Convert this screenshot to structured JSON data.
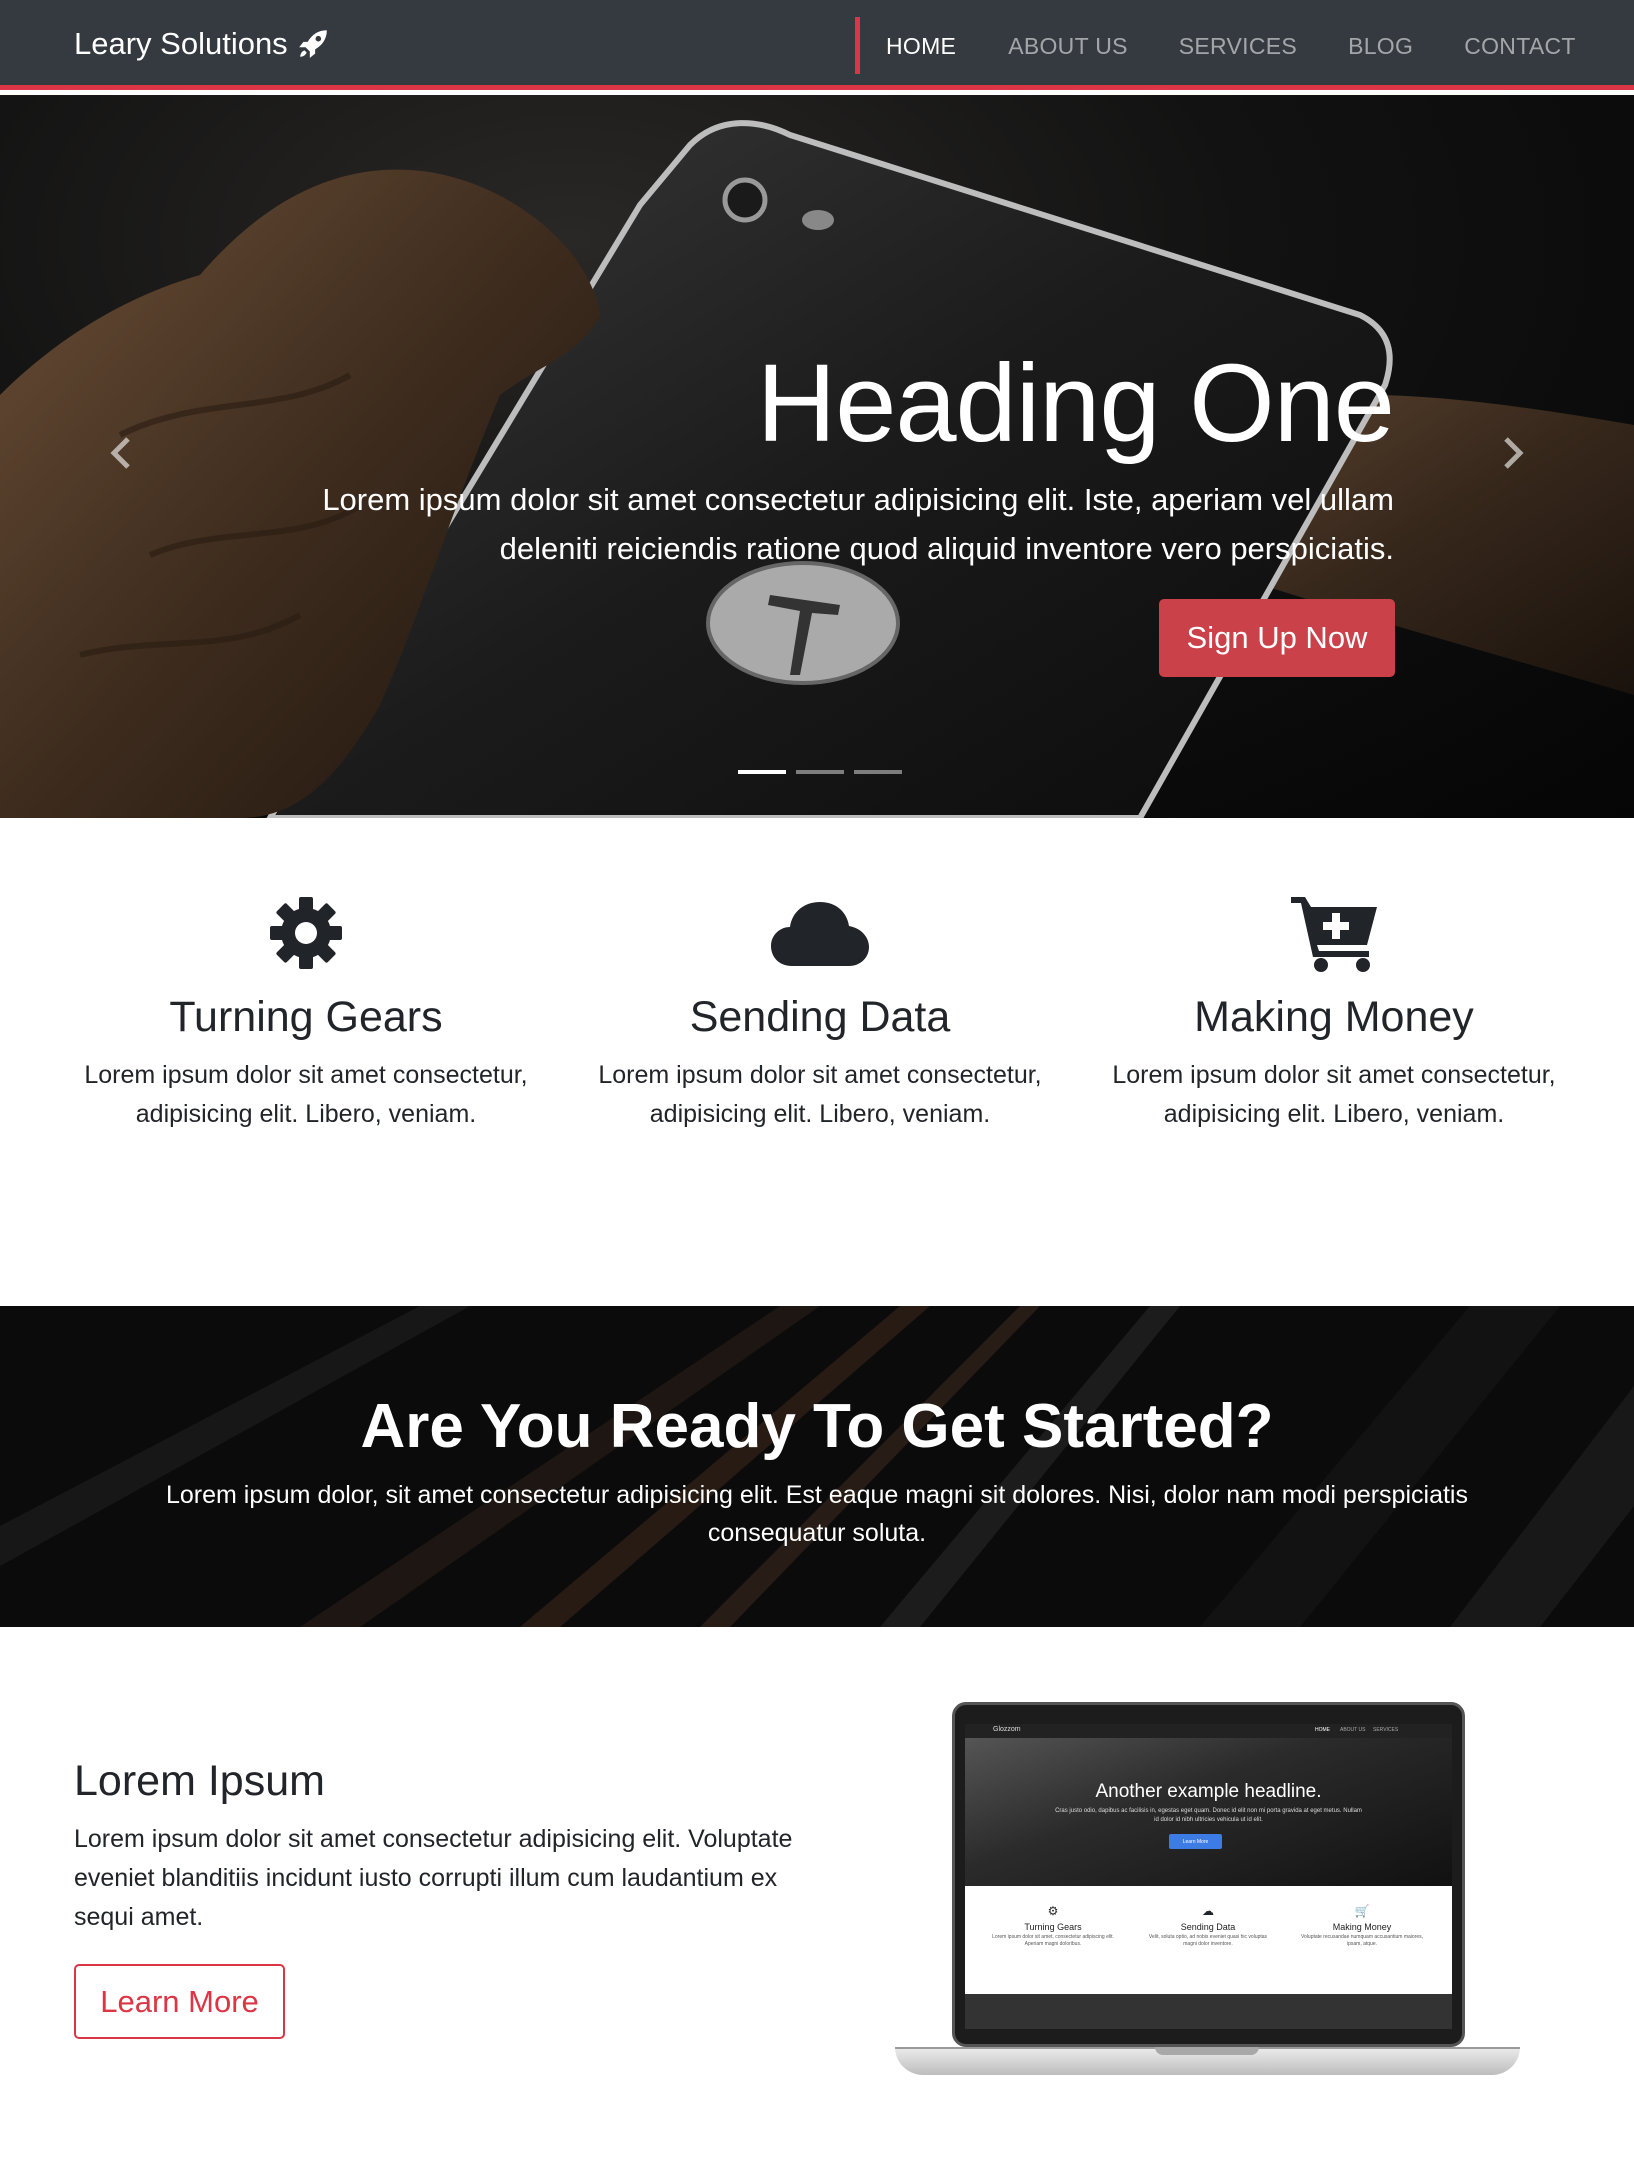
{
  "navbar": {
    "brand": "Leary Solutions",
    "brand_icon": "rocket-icon",
    "links": [
      "HOME",
      "ABOUT US",
      "SERVICES",
      "BLOG",
      "CONTACT"
    ],
    "active": "HOME",
    "accent": "#dc3545",
    "bg": "#343a40"
  },
  "hero": {
    "title": "Heading One",
    "text": "Lorem ipsum dolor sit amet consectetur adipisicing elit. Iste, aperiam vel ullam deleniti reiciendis ratione quod aliquid inventore vero perspiciatis.",
    "button": "Sign Up Now",
    "button_color": "#ca414a",
    "slides": 3,
    "active_slide": 1
  },
  "features": [
    {
      "icon": "gear-icon",
      "title": "Turning Gears",
      "text": "Lorem ipsum dolor sit amet consectetur, adipisicing elit. Libero, veniam."
    },
    {
      "icon": "cloud-icon",
      "title": "Sending Data",
      "text": "Lorem ipsum dolor sit amet consectetur, adipisicing elit. Libero, veniam."
    },
    {
      "icon": "cart-plus-icon",
      "title": "Making Money",
      "text": "Lorem ipsum dolor sit amet consectetur, adipisicing elit. Libero, veniam."
    }
  ],
  "cta": {
    "title": "Are You Ready To Get Started?",
    "text": "Lorem ipsum dolor, sit amet consectetur adipisicing elit. Est eaque magni sit dolores. Nisi, dolor nam modi perspiciatis consequatur soluta."
  },
  "about": {
    "title": "Lorem Ipsum",
    "text": "Lorem ipsum dolor sit amet consectetur adipisicing elit. Voluptate eveniet blanditiis incidunt iusto corrupti illum cum laudantium ex sequi amet.",
    "button": "Learn More"
  },
  "laptop_screen": {
    "brand": "Glozzom",
    "links": [
      "HOME",
      "ABOUT US",
      "SERVICES"
    ],
    "headline": "Another example headline.",
    "text": "Cras justo odio, dapibus ac facilisis in, egestas eget quam. Donec id elit non mi porta gravida at eget metus. Nullam id dolor id nibh ultricies vehicula ut id elit.",
    "button": "Learn More",
    "features": [
      {
        "title": "Turning Gears",
        "text": "Lorem ipsum dolor sit amet, consectetur adipiscing elit. Aperiam magni doloribus."
      },
      {
        "title": "Sending Data",
        "text": "Velit, soluta optio, ad nobis eveniet quasi hic voluptas magni dolor inventore."
      },
      {
        "title": "Making Money",
        "text": "Voluptate recusandae numquam accusantium maiores, ipsam, atque."
      }
    ]
  }
}
